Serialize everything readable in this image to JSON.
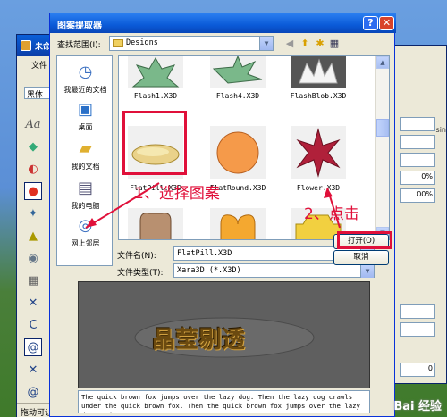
{
  "bg_app": {
    "title": "未命",
    "menu": "文件",
    "font": "黑体",
    "status": "拖动可让",
    "right_texts": [
      "sin",
      "0%",
      "00%",
      "0"
    ]
  },
  "dialog": {
    "title": "图案提取器",
    "lookin_label": "查找范围(I):",
    "lookin_value": "Designs",
    "places": [
      "我最近的文档",
      "桌面",
      "我的文档",
      "我的电脑",
      "网上邻居"
    ],
    "files": [
      {
        "name": "Flash1.X3D"
      },
      {
        "name": "Flash4.X3D"
      },
      {
        "name": "FlashBlob.X3D"
      },
      {
        "name": "FlatPill.X3D"
      },
      {
        "name": "FlatRound.X3D"
      },
      {
        "name": "Flower.X3D"
      },
      {
        "name": ""
      },
      {
        "name": ""
      },
      {
        "name": ""
      }
    ],
    "filename_label": "文件名(N):",
    "filename_value": "FlatPill.X3D",
    "filetype_label": "文件类型(T):",
    "filetype_value": "Xara3D (*.X3D)",
    "open_button": "打开(O)",
    "cancel_button": "取消",
    "preview_text": "晶莹剔透",
    "sample_text": "The quick brown fox jumps over the lazy dog. Then the lazy dog crawls under the quick brown fox. Then the quick brown fox jumps over the lazy dog again."
  },
  "annotations": {
    "step1": "1、选择图案",
    "step2": "2、点击"
  },
  "watermark": "Bai 经验"
}
